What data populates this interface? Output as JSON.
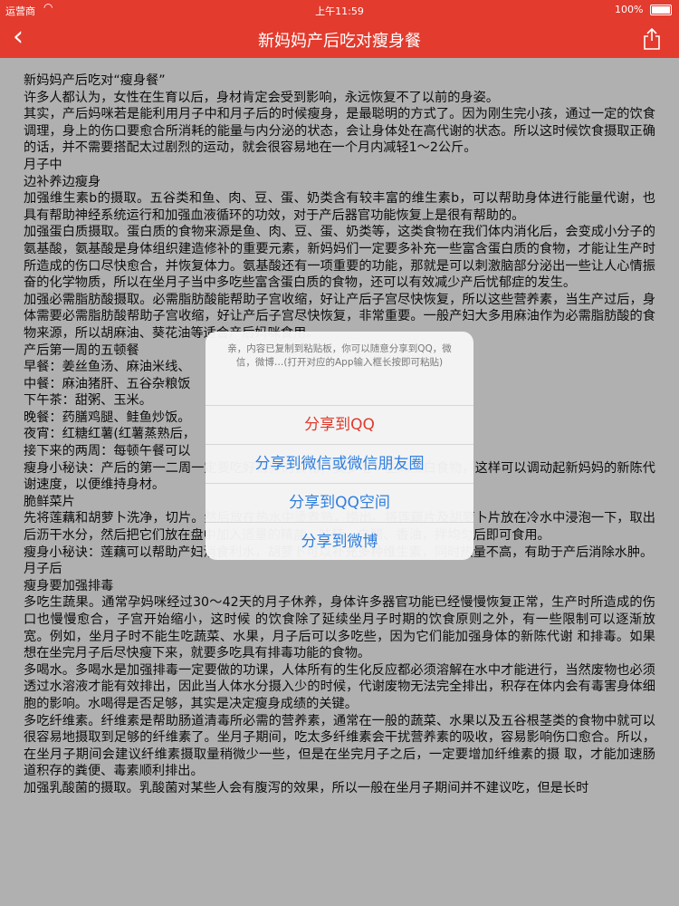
{
  "status_bar": {
    "carrier": "运营商",
    "time": "上午11:59",
    "battery": "100%"
  },
  "nav": {
    "title": "新妈妈产后吃对瘦身餐"
  },
  "article": {
    "paragraphs": [
      "新妈妈产后吃对“瘦身餐”",
      "许多人都认为，女性在生育以后，身材肯定会受到影响，永远恢复不了以前的身姿。",
      "其实，产后妈咪若是能利用月子中和月子后的时候瘦身，是最聪明的方式了。因为刚生完小孩，通过一定的饮食调理，身上的伤口要愈合所消耗的能量与内分泌的状态，会让身体处在高代谢的状态。所以这时候饮食摄取正确的话，并不需要搭配太过剧烈的运动，就会很容易地在一个月内减轻1～2公斤。",
      "月子中",
      "边补养边瘦身",
      "加强维生素b的摄取。五谷类和鱼、肉、豆、蛋、奶类含有较丰富的维生素b，可以帮助身体进行能量代谢，也具有帮助神经系统运行和加强血液循环的功效，对于产后器官功能恢复上是很有帮助的。",
      "加强蛋白质摄取。蛋白质的食物来源是鱼、肉、豆、蛋、奶类等，这类食物在我们体内消化后，会变成小分子的氨基酸，氨基酸是身体组织建造修补的重要元素，新妈妈们一定要多补充一些富含蛋白质的食物，才能让生产时所造成的伤口尽快愈合，并恢复体力。氨基酸还有一项重要的功能，那就是可以刺激脑部分泌出一些让人心情振奋的化学物质，所以在坐月子当中多吃些富含蛋白质的食物，还可以有效减少产后忧郁症的发生。",
      "加强必需脂肪酸摄取。必需脂肪酸能帮助子宫收缩，好让产后子宫尽快恢复，所以这些营养素，当生产过后，身体需要必需脂肪酸帮助子宫收缩，好让产后子宫尽快恢复，非常重要。一般产妇大多用麻油作为必需脂肪酸的食物来源，所以胡麻油、葵花油等适合产后妈咪食用。",
      "产后第一周的五顿餐",
      "早餐：姜丝鱼汤、麻油米线、",
      "中餐：麻油猪肝、五谷杂粮饭",
      "下午茶：甜粥、玉米。",
      "晚餐：药膳鸡腿、鲑鱼炒饭。",
      "夜宵：红糖红薯(红薯蒸熟后，",
      "接下来的两周：每顿午餐可以",
      "瘦身小秘诀：产后的第一二周一定要吃好营养的食物，要多吃一些高蛋白食物，这样可以调动起新妈妈的新陈代谢速度，以便维持身材。",
      "脆鲜菜片",
      "先将莲藕和胡萝卜洗净，切片。然后放在热水中烫煮熟，捞出。将莲藕片及胡萝卜片放在冷水中浸泡一下，取出后沥干水分，然后把它们放在盘中加入适量的精盐、味精、白醋、香油，拌均匀后即可食用。",
      "瘦身小秘诀：莲藕可以帮助产妇消食利水，胡萝卜可以补充多种维生素，同时热量不高，有助于产后消除水肿。",
      "月子后",
      "瘦身要加强排毒",
      "多吃生蔬果。通常孕妈咪经过30～42天的月子休养，身体许多器官功能已经慢慢恢复正常，生产时所造成的伤口也慢慢愈合，子宫开始缩小，这时候 的饮食除了延续坐月子时期的饮食原则之外，有一些限制可以逐渐放宽。例如，坐月子时不能生吃蔬菜、水果，月子后可以多吃些，因为它们能加强身体的新陈代谢 和排毒。如果想在坐完月子后尽快瘦下来，就要多吃具有排毒功能的食物。",
      "多喝水。多喝水是加强排毒一定要做的功课，人体所有的生化反应都必须溶解在水中才能进行，当然废物也必须透过水溶液才能有效排出，因此当人体水分摄入少的时候，代谢废物无法完全排出，积存在体内会有毒害身体细胞的影响。水喝得是否足够，其实是决定瘦身成绩的关键。",
      "多吃纤维素。纤维素是帮助肠道清毒所必需的营养素，通常在一般的蔬菜、水果以及五谷根茎类的食物中就可以很容易地摄取到足够的纤维素了。坐月子期间，吃太多纤维素会干扰营养素的吸收，容易影响伤口愈合。所以，在坐月子期间会建议纤维素摄取量稍微少一些，但是在坐完月子之后，一定要增加纤维素的摄 取，才能加速肠道积存的粪便、毒素顺利排出。",
      "加强乳酸菌的摄取。乳酸菌对某些人会有腹泻的效果，所以一般在坐月子期间并不建议吃，但是长时"
    ]
  },
  "dialog": {
    "message": "亲，内容已复制到粘贴板，你可以随意分享到QQ，微信，微博…(打开对应的App输入框长按即可粘贴)",
    "options": [
      {
        "label": "分享到QQ",
        "color": "#e03a2c"
      },
      {
        "label": "分享到微信或微信朋友圈",
        "color": "#2f7fe0"
      },
      {
        "label": "分享到QQ空间",
        "color": "#2f7fe0"
      },
      {
        "label": "分享到微博",
        "color": "#2f7fe0"
      }
    ]
  }
}
